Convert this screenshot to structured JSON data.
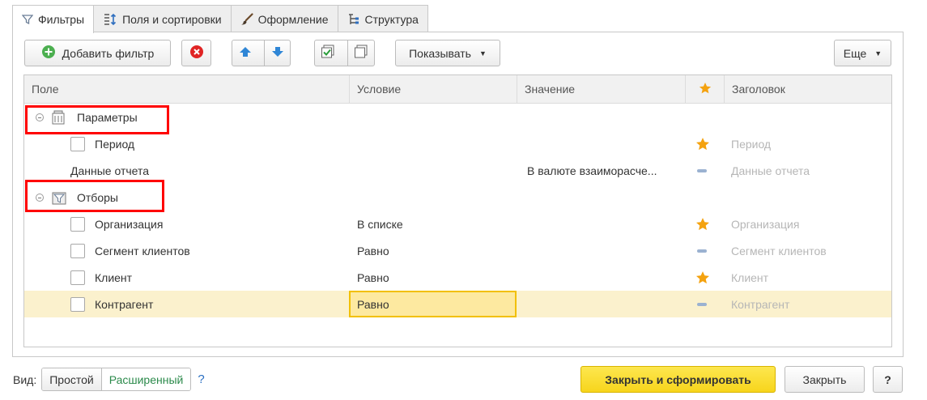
{
  "tabs": [
    {
      "label": "Фильтры",
      "icon": "filter-icon",
      "active": true
    },
    {
      "label": "Поля и сортировки",
      "icon": "fields-sort-icon"
    },
    {
      "label": "Оформление",
      "icon": "brush-icon"
    },
    {
      "label": "Структура",
      "icon": "structure-icon"
    }
  ],
  "toolbar": {
    "add_filter": "Добавить фильтр",
    "show_label": "Показывать",
    "more_label": "Еще"
  },
  "columns": {
    "field": "Поле",
    "condition": "Условие",
    "value": "Значение",
    "title": "Заголовок"
  },
  "groups": {
    "params": "Параметры",
    "filters": "Отборы"
  },
  "rows": {
    "period": {
      "field": "Период",
      "condition": "",
      "value": "",
      "title": "Период",
      "mark": "star"
    },
    "report_data": {
      "field": "Данные отчета",
      "condition": "",
      "value": "В валюте взаиморасче...",
      "title": "Данные отчета",
      "mark": "dash"
    },
    "organization": {
      "field": "Организация",
      "condition": "В списке",
      "value": "",
      "title": "Организация",
      "mark": "star"
    },
    "segment": {
      "field": "Сегмент клиентов",
      "condition": "Равно",
      "value": "",
      "title": "Сегмент клиентов",
      "mark": "dash"
    },
    "client": {
      "field": "Клиент",
      "condition": "Равно",
      "value": "",
      "title": "Клиент",
      "mark": "star"
    },
    "counterparty": {
      "field": "Контрагент",
      "condition": "Равно",
      "value": "",
      "title": "Контрагент",
      "mark": "dash"
    }
  },
  "bottom": {
    "view_label": "Вид:",
    "simple": "Простой",
    "advanced": "Расширенный",
    "help_link": "?",
    "close_and_build": "Закрыть и сформировать",
    "close": "Закрыть",
    "help": "?"
  },
  "colors": {
    "star": "#f4a20f",
    "highlight_row": "#fbf1cd",
    "edit_cell": "#fde9a0",
    "primary_button": "#f7d51c",
    "annotation_box": "#ff0000"
  }
}
